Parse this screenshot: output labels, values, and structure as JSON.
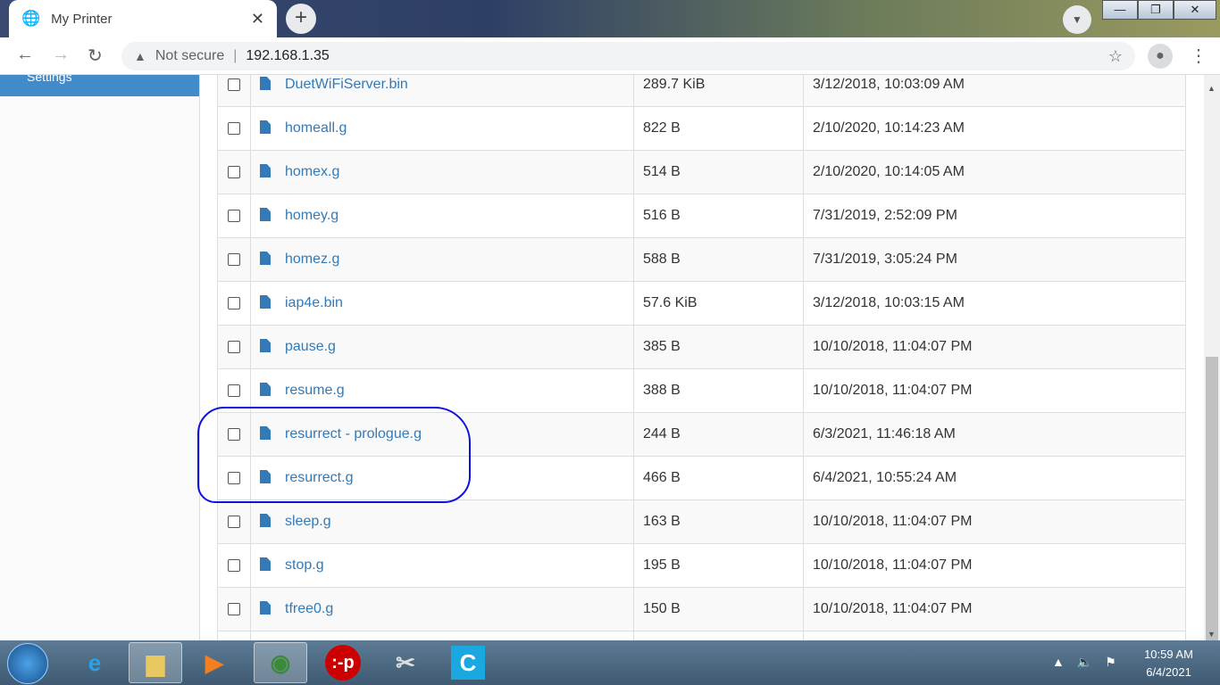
{
  "browser": {
    "tab_title": "My Printer",
    "address": "192.168.1.35",
    "security": "Not secure"
  },
  "sidebar": {
    "active_item": "Settings"
  },
  "files": [
    {
      "name": "DuetWiFiServer.bin",
      "size": "289.7 KiB",
      "date": "3/12/2018, 10:03:09 AM"
    },
    {
      "name": "homeall.g",
      "size": "822 B",
      "date": "2/10/2020, 10:14:23 AM"
    },
    {
      "name": "homex.g",
      "size": "514 B",
      "date": "2/10/2020, 10:14:05 AM"
    },
    {
      "name": "homey.g",
      "size": "516 B",
      "date": "7/31/2019, 2:52:09 PM"
    },
    {
      "name": "homez.g",
      "size": "588 B",
      "date": "7/31/2019, 3:05:24 PM"
    },
    {
      "name": "iap4e.bin",
      "size": "57.6 KiB",
      "date": "3/12/2018, 10:03:15 AM"
    },
    {
      "name": "pause.g",
      "size": "385 B",
      "date": "10/10/2018, 11:04:07 PM"
    },
    {
      "name": "resume.g",
      "size": "388 B",
      "date": "10/10/2018, 11:04:07 PM"
    },
    {
      "name": "resurrect - prologue.g",
      "size": "244 B",
      "date": "6/3/2021, 11:46:18 AM"
    },
    {
      "name": "resurrect.g",
      "size": "466 B",
      "date": "6/4/2021, 10:55:24 AM"
    },
    {
      "name": "sleep.g",
      "size": "163 B",
      "date": "10/10/2018, 11:04:07 PM"
    },
    {
      "name": "stop.g",
      "size": "195 B",
      "date": "10/10/2018, 11:04:07 PM"
    },
    {
      "name": "tfree0.g",
      "size": "150 B",
      "date": "10/10/2018, 11:04:07 PM"
    },
    {
      "name": "",
      "size": "",
      "date": ""
    }
  ],
  "annotation_color": "#1010e0",
  "taskbar": {
    "time": "10:59 AM",
    "date": "6/4/2021",
    "apps": [
      "start",
      "internet-explorer",
      "file-explorer",
      "media-player",
      "chrome",
      "p-app",
      "snipping-tool",
      "c-app"
    ]
  }
}
